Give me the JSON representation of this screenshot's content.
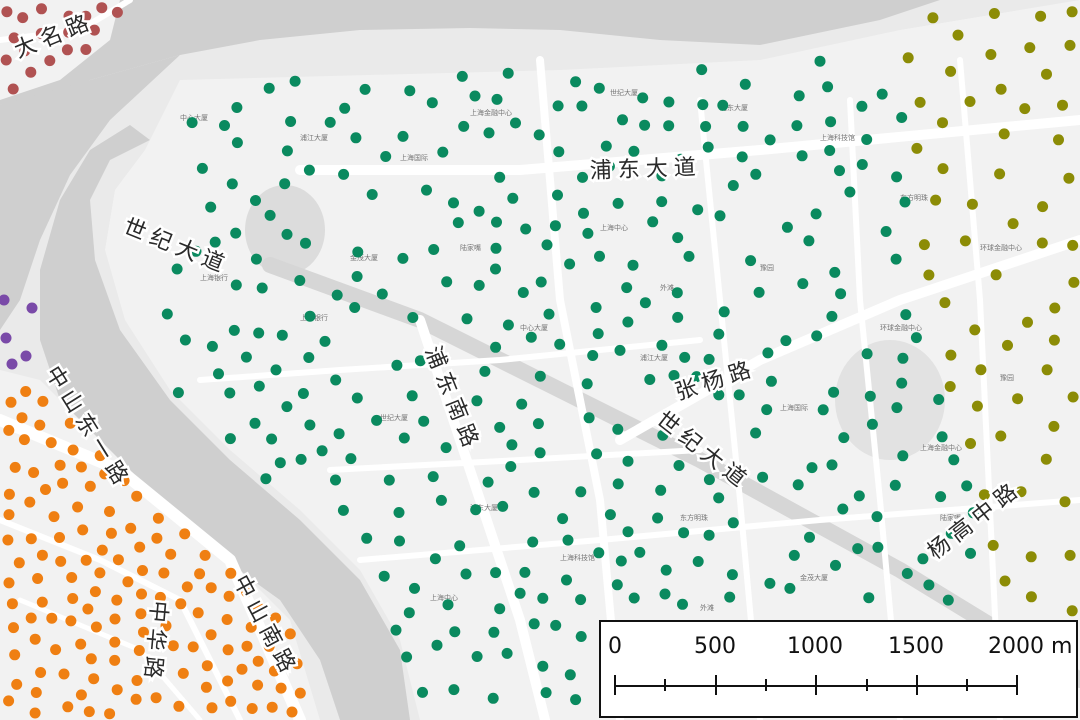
{
  "map": {
    "background": "#eaeaea",
    "water_color": "#cfcfcf",
    "land_color": "#f2f2f2",
    "road_color": "#ffffff",
    "major_road_color": "#d8d8d8",
    "point_colors": {
      "green": "#0a8a5f",
      "orange": "#ef7f12",
      "olive": "#8c8c06",
      "brown": "#b05252",
      "purple": "#7a4aa8"
    }
  },
  "road_labels": {
    "damin": "大名路",
    "pudong_dadao": "浦东大道",
    "shiji_dadao_west": "世纪大道",
    "shiji_dadao_east": "世纪大道",
    "pudong_nanlu": "浦东南路",
    "zhangyang_lu": "张杨路",
    "yanggao_zhonglu": "杨高中路",
    "zhongshan_dongyi": "中山东一路",
    "zhongshan_nanlu": "中山南路",
    "zhonghua_lu": "中华路"
  },
  "poi_labels": [
    "中心大厦",
    "浦江大厦",
    "上海国际",
    "上海金融中心",
    "世纪大厦",
    "浦东大厦",
    "上海科技馆",
    "东方明珠",
    "金茂大厦",
    "陆家嘴",
    "上海中心",
    "外滩",
    "豫园",
    "环球金融中心",
    "上海银行"
  ],
  "scale_bar": {
    "labels": [
      "0",
      "500",
      "1000",
      "1500",
      "2000 m"
    ]
  }
}
